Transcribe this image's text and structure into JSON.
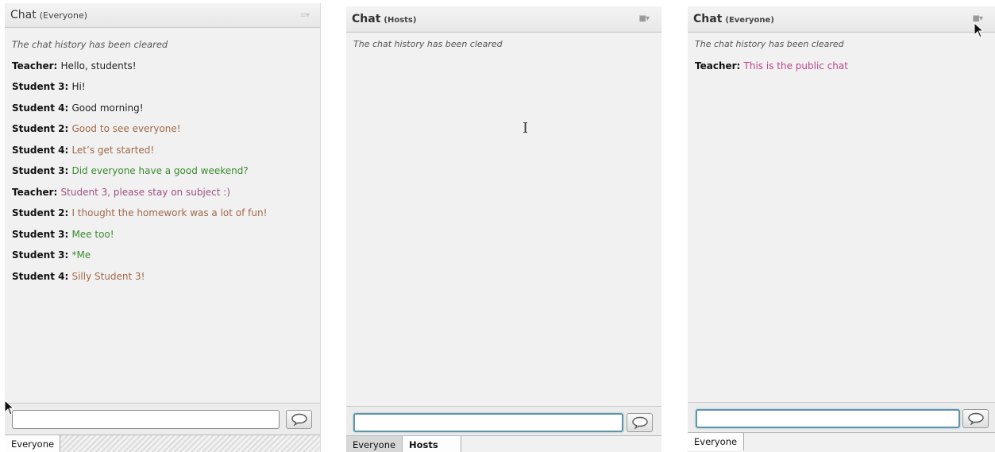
{
  "panels": [
    {
      "title": "Chat",
      "scope": "(Everyone)",
      "messages": [
        {
          "system": "The chat history has been cleared"
        },
        {
          "sender": "Teacher",
          "text": "Hello, students!",
          "color": "#222222"
        },
        {
          "sender": "Student 3",
          "text": "Hi!",
          "color": "#222222"
        },
        {
          "sender": "Student 4",
          "text": "Good morning!",
          "color": "#222222"
        },
        {
          "sender": "Student 2",
          "text": "Good to see everyone!",
          "color": "#a0694a"
        },
        {
          "sender": "Student 4",
          "text": "Let’s get started!",
          "color": "#a0694a"
        },
        {
          "sender": "Student 3",
          "text": "Did everyone have a good weekend?",
          "color": "#3a8a2e"
        },
        {
          "sender": "Teacher",
          "text": "Student 3, please stay on subject :)",
          "color": "#a04f86"
        },
        {
          "sender": "Student 2",
          "text": "I thought the homework was a lot of fun!",
          "color": "#a0694a"
        },
        {
          "sender": "Student 3",
          "text": "Mee too!",
          "color": "#3a8a2e"
        },
        {
          "sender": "Student 3",
          "text": "*Me",
          "color": "#3a8a2e"
        },
        {
          "sender": "Student 4",
          "text": "Silly Student 3!",
          "color": "#a0694a"
        }
      ],
      "input_value": "",
      "tabs": [
        "Everyone"
      ]
    },
    {
      "title": "Chat",
      "scope": "(Hosts)",
      "messages": [
        {
          "system": "The chat history has been cleared"
        }
      ],
      "input_value": "",
      "tabs": [
        "Everyone",
        "Hosts"
      ]
    },
    {
      "title": "Chat",
      "scope": "(Everyone)",
      "messages": [
        {
          "system": "The chat history has been cleared"
        },
        {
          "sender": "Teacher",
          "text": "This is the public chat",
          "color": "#c0438f"
        }
      ],
      "input_value": "",
      "tabs": [
        "Everyone"
      ]
    }
  ],
  "icons": {
    "menu": "menu-dropdown-icon",
    "send": "speech-bubble-icon",
    "text_cursor": "text-cursor-icon",
    "pointer": "mouse-pointer-icon"
  }
}
